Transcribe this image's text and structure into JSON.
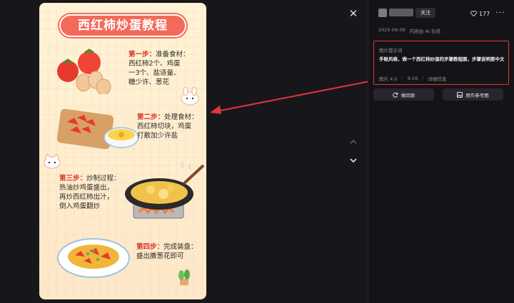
{
  "poster": {
    "title": "西红柿炒蛋教程",
    "steps": [
      {
        "head": "第一步：",
        "lines": [
          "准备食材：",
          "西红柿2个、鸡蛋",
          "一3个、盐适量、",
          "糖少许、葱花"
        ]
      },
      {
        "head": "第二步：",
        "lines": [
          "处理食材：",
          "西红柿切块，鸡蛋",
          "打散加少许盐"
        ]
      },
      {
        "head": "第三步：",
        "lines": [
          "炒制过程：",
          "热油炒鸡蛋盛出，",
          "再炒西红柿出汁，",
          "倒入鸡蛋翻炒"
        ]
      },
      {
        "head": "第四步：",
        "lines": [
          "完成装盘：",
          "盛出撒葱花即可"
        ]
      }
    ]
  },
  "sidebar": {
    "follow_label": "关注",
    "like_count": "177",
    "meta": {
      "date": "2025-09-09",
      "source": "内容由 AI 生成"
    },
    "prompt": {
      "label": "图片提示词",
      "text": "手账风格，做一个西红柿炒蛋的步骤教程图，步骤说明要中文",
      "model": "图片 4.0",
      "ratio": "9:16",
      "details_label": "详细信息"
    },
    "buttons": {
      "same_style": "做同款",
      "use_as_reference": "用作参考图"
    }
  },
  "colors": {
    "accent_red": "#e0363a",
    "title_red": "#f46a5a",
    "step_red": "#d9342b"
  }
}
